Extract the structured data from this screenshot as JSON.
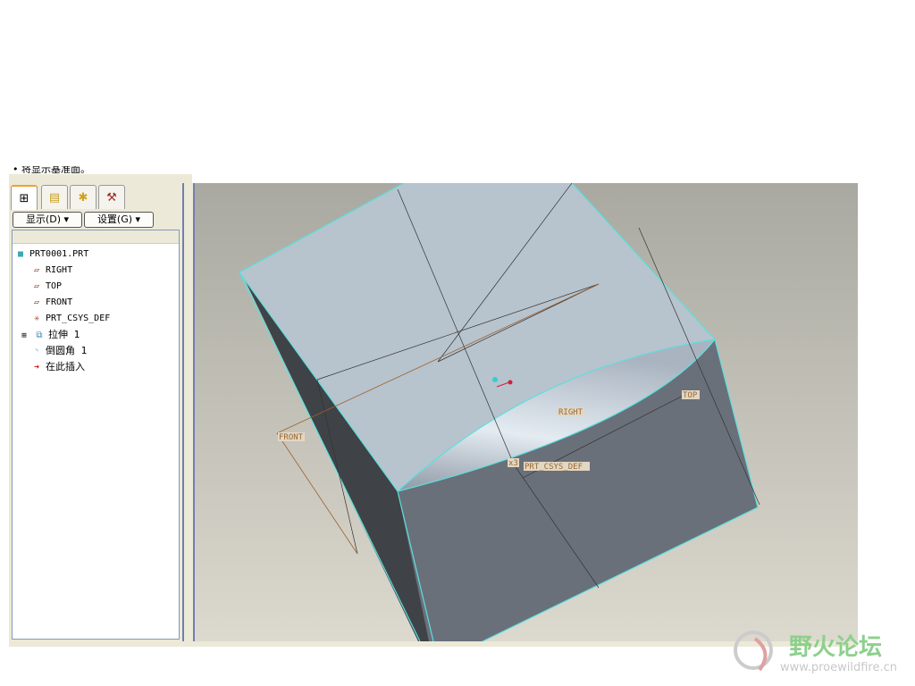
{
  "message": "• 将显示基准面。",
  "tabs": [
    {
      "icon": "model-tree-icon"
    },
    {
      "icon": "layers-icon"
    },
    {
      "icon": "folder-favorites-icon"
    },
    {
      "icon": "tools-icon"
    }
  ],
  "buttons": {
    "show": "显示(D) ▾",
    "settings": "设置(G) ▾"
  },
  "tree": [
    {
      "label": "PRT0001.PRT",
      "icon": "part-icon"
    },
    {
      "label": "RIGHT",
      "icon": "datum-plane-icon"
    },
    {
      "label": "TOP",
      "icon": "datum-plane-icon"
    },
    {
      "label": "FRONT",
      "icon": "datum-plane-icon"
    },
    {
      "label": "PRT_CSYS_DEF",
      "icon": "csys-icon"
    },
    {
      "label": "拉伸 1",
      "icon": "extrude-icon"
    },
    {
      "label": "倒圆角 1",
      "icon": "round-icon"
    },
    {
      "label": "在此插入",
      "icon": "insert-here-arrow-icon"
    }
  ],
  "viewport_labels": {
    "front": "FRONT",
    "right": "RIGHT",
    "top": "TOP",
    "csys": "PRT_CSYS_DEF",
    "csys_tag": "x3"
  },
  "watermark": {
    "title": "野火论坛",
    "url": "www.proewildfire.cn"
  }
}
